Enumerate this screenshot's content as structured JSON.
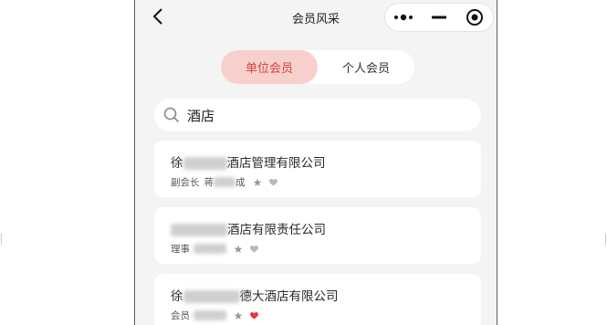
{
  "navbar": {
    "title": "会员风采",
    "back_icon": "chevron-left-icon",
    "more_icon": "more-dots-icon",
    "minimize_icon": "minus-icon",
    "close_icon": "target-circle-icon"
  },
  "tabs": [
    {
      "label": "单位会员",
      "active": true
    },
    {
      "label": "个人会员",
      "active": false
    }
  ],
  "search": {
    "value": "酒店",
    "icon": "search-icon"
  },
  "members": [
    {
      "name_prefix": "徐",
      "name_suffix": "酒店管理有限公司",
      "role": "副会长",
      "person_prefix": "蒋",
      "person_suffix": "成",
      "heart_color": "#b8b8b8"
    },
    {
      "name_prefix": "",
      "name_suffix": "酒店有限责任公司",
      "role": "理事",
      "person_prefix": "",
      "person_suffix": "",
      "heart_color": "#b8b8b8"
    },
    {
      "name_prefix": "徐",
      "name_suffix": "德大酒店有限公司",
      "role": "会员",
      "person_prefix": "",
      "person_suffix": "",
      "heart_color": "#e53935"
    }
  ],
  "colors": {
    "accent": "#d1453b",
    "tab_active_bg": "#f8d0cb"
  }
}
